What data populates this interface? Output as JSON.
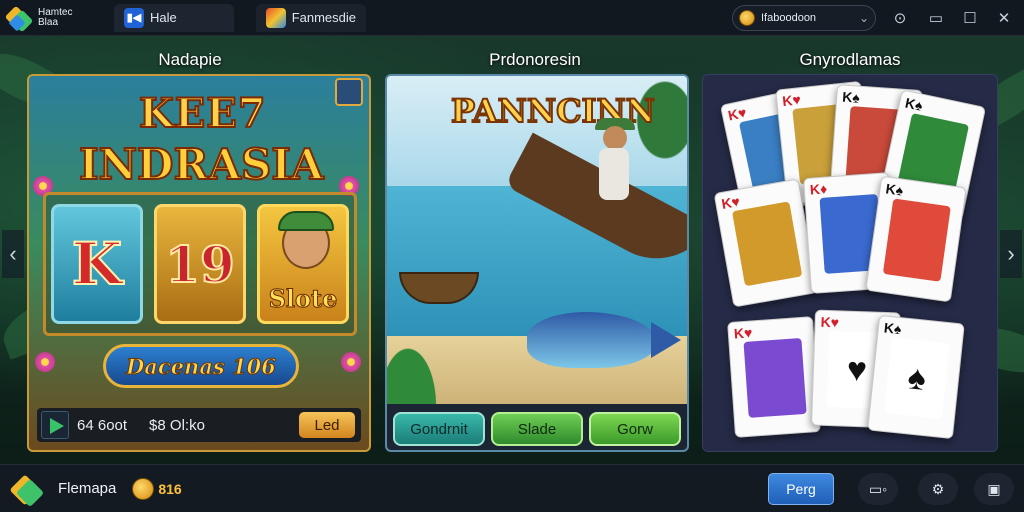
{
  "app": {
    "name": "Hamtec Blaa",
    "logo_icon": "app-logo-icon"
  },
  "tabs": [
    {
      "label": "Hale",
      "icon": "home-tab-icon"
    },
    {
      "label": "Fanmesdie",
      "icon": "game-tab-icon"
    }
  ],
  "account": {
    "label": "Ifaboodoon",
    "icon": "coin-icon"
  },
  "window_controls": [
    "help-icon",
    "minimize-icon",
    "maximize-icon",
    "close-icon"
  ],
  "columns": [
    {
      "heading": "Nadapie"
    },
    {
      "heading": "Prdonoresin"
    },
    {
      "heading": "Gnyrodlamas"
    }
  ],
  "slot": {
    "title_line1": "KEE7",
    "title_line2": "INDRASIA",
    "reels": [
      "K",
      "19",
      "Slote"
    ],
    "banner": "Dacenas 106",
    "stats_left": "64 6oot",
    "stats_right": "$8 Ol:ko",
    "action": "Led"
  },
  "fishing": {
    "title": "PANNCINN",
    "buttons": [
      "Gondrnit",
      "Slade",
      "Gorw"
    ]
  },
  "cards": {
    "items": [
      {
        "rank": "K",
        "suit": "♥",
        "color": "red"
      },
      {
        "rank": "K",
        "suit": "♥",
        "color": "red"
      },
      {
        "rank": "K",
        "suit": "♠",
        "color": "blk"
      },
      {
        "rank": "K",
        "suit": "♠",
        "color": "blk"
      },
      {
        "rank": "K",
        "suit": "♥",
        "color": "red"
      },
      {
        "rank": "K",
        "suit": "♦",
        "color": "red"
      },
      {
        "rank": "K",
        "suit": "♠",
        "color": "blk"
      },
      {
        "rank": "K",
        "suit": "♥",
        "color": "red"
      },
      {
        "rank": "K",
        "suit": "♥",
        "color": "red"
      },
      {
        "rank": "K",
        "suit": "♠",
        "color": "blk"
      }
    ]
  },
  "dock": {
    "name": "Flemapa",
    "coins": "816",
    "play_label": "Perg",
    "icons": [
      "screen-record-icon",
      "settings-icon",
      "save-icon"
    ]
  },
  "colors": {
    "accent_gold": "#ffd24a",
    "play_blue": "#2f74cc",
    "card_panel": "#252a46"
  }
}
